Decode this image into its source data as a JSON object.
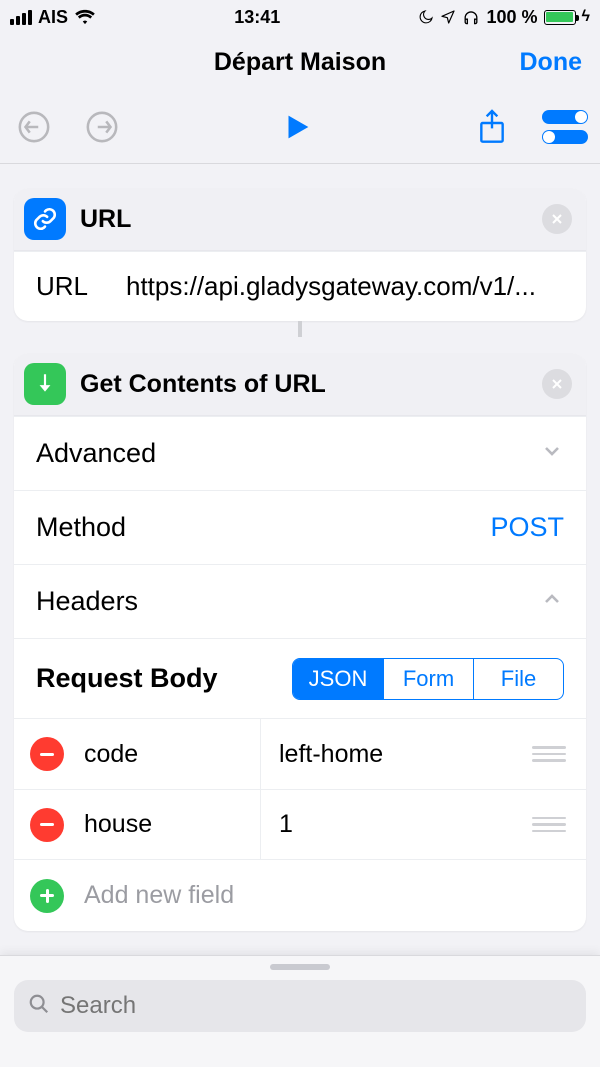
{
  "status": {
    "carrier": "AIS",
    "time": "13:41",
    "battery_pct": "100 %"
  },
  "nav": {
    "title": "Départ Maison",
    "done": "Done"
  },
  "url_card": {
    "title": "URL",
    "field_label": "URL",
    "field_value": "https://api.gladysgateway.com/v1/..."
  },
  "gc_card": {
    "title": "Get Contents of URL",
    "rows": {
      "advanced": "Advanced",
      "method_label": "Method",
      "method_value": "POST",
      "headers": "Headers",
      "body_label": "Request Body"
    },
    "seg": {
      "json": "JSON",
      "form": "Form",
      "file": "File"
    },
    "fields": [
      {
        "key": "code",
        "value": "left-home"
      },
      {
        "key": "house",
        "value": "1"
      }
    ],
    "add_placeholder": "Add new field"
  },
  "search": {
    "placeholder": "Search"
  }
}
